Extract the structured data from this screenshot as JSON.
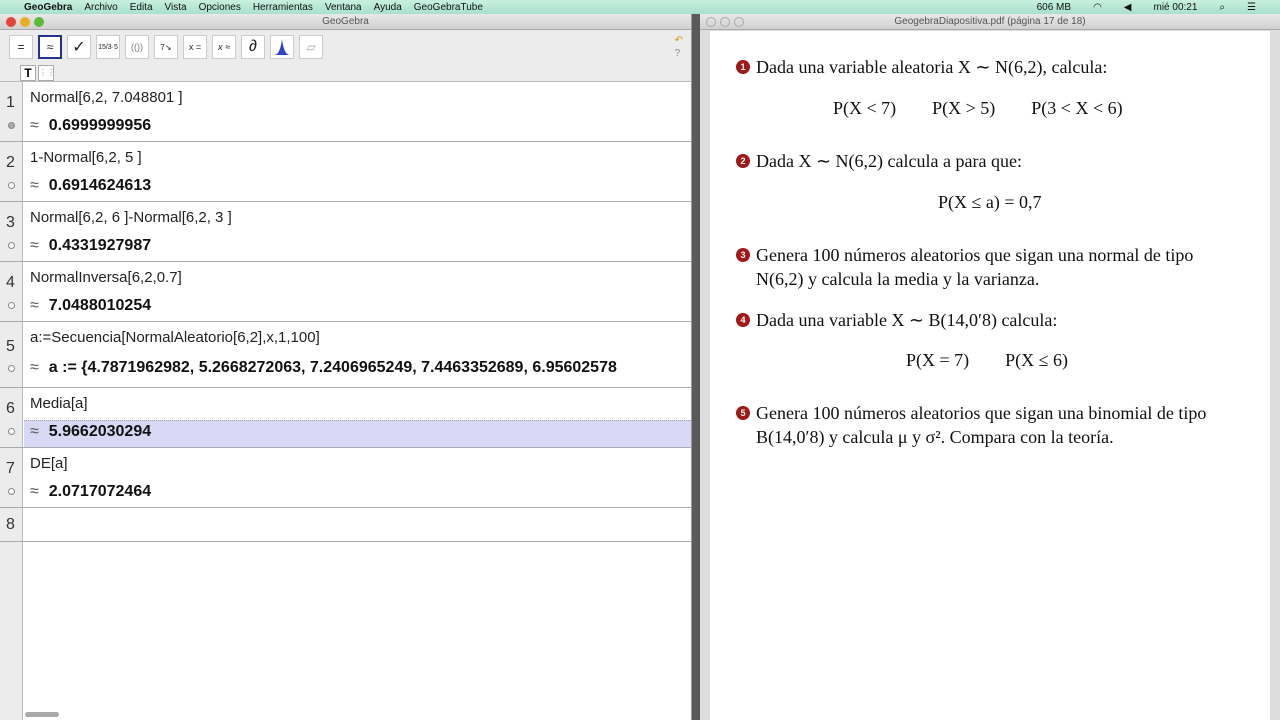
{
  "menubar": {
    "app": "GeoGebra",
    "items": [
      "Archivo",
      "Edita",
      "Vista",
      "Opciones",
      "Herramientas",
      "Ventana",
      "Ayuda",
      "GeoGebraTube"
    ],
    "memory": "606 MB",
    "clock": "mié 00:21"
  },
  "geogebra": {
    "title": "GeoGebra",
    "toolbar": [
      "=",
      "≈",
      "✓",
      "15/3·5",
      "(())",
      "7↘",
      "x =",
      "x ≈",
      "∂",
      "normal",
      "eraser"
    ],
    "stylebar": [
      "T",
      "⋮⋮"
    ],
    "rows": [
      {
        "n": "1",
        "input": "Normal[6,2, 7.048801 ]",
        "output": "0.6999999956"
      },
      {
        "n": "2",
        "input": "1-Normal[6,2, 5 ]",
        "output": "0.6914624613"
      },
      {
        "n": "3",
        "input": "Normal[6,2, 6 ]-Normal[6,2, 3 ]",
        "output": "0.4331927987"
      },
      {
        "n": "4",
        "input": "NormalInversa[6,2,0.7]",
        "output": "7.0488010254"
      },
      {
        "n": "5",
        "input": "a:=Secuencia[NormalAleatorio[6,2],x,1,100]",
        "output": "a := {4.7871962982, 5.2668272063, 7.2406965249, 7.4463352689, 6.95602578"
      },
      {
        "n": "6",
        "input": "Media[a]",
        "output": "5.9662030294"
      },
      {
        "n": "7",
        "input": "DE[a]",
        "output": "2.0717072464"
      },
      {
        "n": "8",
        "input": "",
        "output": ""
      }
    ],
    "approx": "≈"
  },
  "pdf": {
    "title": "GeogebraDiapositiva.pdf (página 17 de 18)",
    "items": [
      {
        "n": "1",
        "text": "Dada una variable aleatoria X ∼ N(6,2), calcula:",
        "eq": "P(X < 7)        P(X > 5)        P(3 < X < 6)"
      },
      {
        "n": "2",
        "text": "Dada X ∼ N(6,2) calcula a para que:",
        "eq": "P(X ≤ a) = 0,7"
      },
      {
        "n": "3",
        "text": "Genera 100 números aleatorios que sigan una normal de tipo N(6,2) y calcula la media y la varianza."
      },
      {
        "n": "4",
        "text": "Dada una variable X ∼ B(14,0′8) calcula:",
        "eq": "P(X = 7)        P(X ≤ 6)"
      },
      {
        "n": "5",
        "text": "Genera 100 números aleatorios que sigan una binomial de tipo B(14,0′8) y calcula μ y σ². Compara con la teoría."
      }
    ]
  }
}
